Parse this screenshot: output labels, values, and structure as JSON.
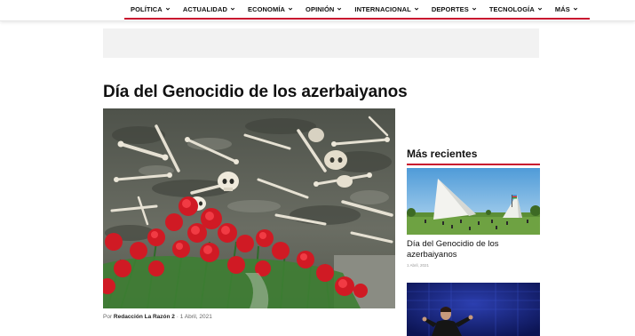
{
  "nav": {
    "items": [
      {
        "label": "POLÍTICA"
      },
      {
        "label": "ACTUALIDAD"
      },
      {
        "label": "ECONOMÍA"
      },
      {
        "label": "OPINIÓN"
      },
      {
        "label": "INTERNACIONAL"
      },
      {
        "label": "DEPORTES"
      },
      {
        "label": "TECNOLOGÍA"
      },
      {
        "label": "MÁS"
      }
    ],
    "icon": "chevron-down-icon"
  },
  "article": {
    "title": "Día del Genocidio de los azerbaiyanos",
    "byline_prefix": "Por ",
    "author": "Redacción La Razón 2",
    "separator": " · ",
    "date": "1 Abril, 2021"
  },
  "sidebar": {
    "heading": "Más recientes",
    "cards": [
      {
        "title": "Día del Genocidio de los azerbaiyanos",
        "date": "1 Abril, 2021"
      }
    ]
  },
  "colors": {
    "accent": "#c8102e",
    "ad_background": "#f2f2f2",
    "text": "#111111"
  }
}
